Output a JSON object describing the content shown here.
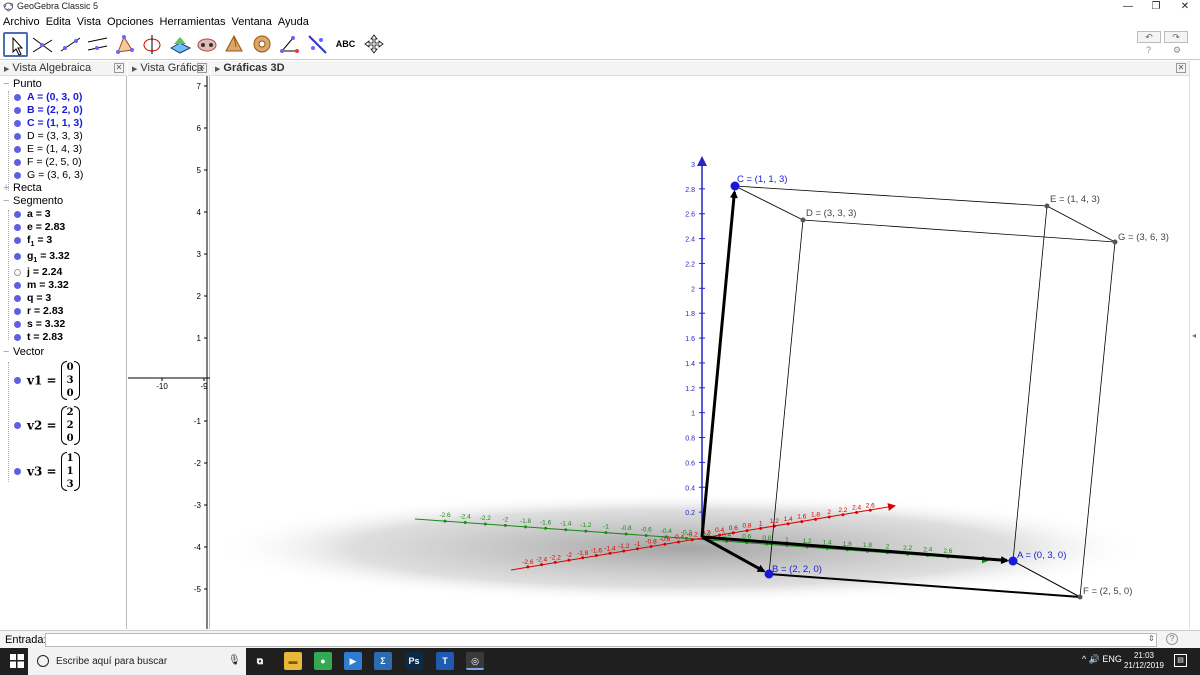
{
  "window": {
    "title": "GeoGebra Classic 5",
    "minimize": "—",
    "maximize": "❐",
    "close": "✕"
  },
  "menu": [
    "Archivo",
    "Edita",
    "Vista",
    "Opciones",
    "Herramientas",
    "Ventana",
    "Ayuda"
  ],
  "toolbar": {
    "tools": [
      "move-tool",
      "point-tool",
      "line-tool",
      "perpendicular-tool",
      "polygon-tool",
      "circle-tool",
      "plane-tool",
      "sphere-tool",
      "pyramid-tool",
      "net-tool",
      "angle-tool",
      "reflect-tool",
      "text-tool",
      "transform-tool"
    ],
    "text_tool_label": "ABC",
    "undo": "↶",
    "redo": "↷",
    "help_icon": "?",
    "settings_icon": "⚙"
  },
  "views": {
    "algebra_title": "Vista Algebraica",
    "graphics2d_title": "Vista Gráfica",
    "graphics3d_title": "Gráficas 3D",
    "close_glyph": "✕"
  },
  "algebra": {
    "categories": {
      "punto": "Punto",
      "recta": "Recta",
      "segmento": "Segmento",
      "vector": "Vector"
    },
    "points": [
      {
        "label": "A = (0, 3, 0)",
        "bold": true
      },
      {
        "label": "B = (2, 2, 0)",
        "bold": true
      },
      {
        "label": "C = (1, 1, 3)",
        "bold": true
      },
      {
        "label": "D = (3, 3, 3)",
        "bold": false
      },
      {
        "label": "E = (1, 4, 3)",
        "bold": false
      },
      {
        "label": "F = (2, 5, 0)",
        "bold": false
      },
      {
        "label": "G = (3, 6, 3)",
        "bold": false
      }
    ],
    "segments": [
      {
        "name": "a",
        "sub": "",
        "value": " = 3",
        "hollow": false
      },
      {
        "name": "e",
        "sub": "",
        "value": " = 2.83",
        "hollow": false
      },
      {
        "name": "f",
        "sub": "1",
        "value": " = 3",
        "hollow": false
      },
      {
        "name": "g",
        "sub": "1",
        "value": " = 3.32",
        "hollow": false
      },
      {
        "name": "j",
        "sub": "",
        "value": " = 2.24",
        "hollow": true
      },
      {
        "name": "m",
        "sub": "",
        "value": " = 3.32",
        "hollow": false
      },
      {
        "name": "q",
        "sub": "",
        "value": " = 3",
        "hollow": false
      },
      {
        "name": "r",
        "sub": "",
        "value": " = 2.83",
        "hollow": false
      },
      {
        "name": "s",
        "sub": "",
        "value": " = 3.32",
        "hollow": false
      },
      {
        "name": "t",
        "sub": "",
        "value": " = 2.83",
        "hollow": false
      }
    ],
    "vectors": [
      {
        "name": "v1 =",
        "components": [
          "0",
          "3",
          "0"
        ]
      },
      {
        "name": "v2 =",
        "components": [
          "2",
          "2",
          "0"
        ]
      },
      {
        "name": "v3 =",
        "components": [
          "1",
          "1",
          "3"
        ]
      }
    ]
  },
  "graphics2d": {
    "y_ticks": [
      "7",
      "6",
      "5",
      "4",
      "3",
      "2",
      "1",
      "-1",
      "-2",
      "-3",
      "-4",
      "-5"
    ],
    "x_ticks": [
      "-10",
      "-9"
    ]
  },
  "graphics3d": {
    "z_ticks": [
      "3",
      "2.8",
      "2.6",
      "2.4",
      "2.2",
      "2",
      "1.8",
      "1.6",
      "1.4",
      "1.2",
      "1",
      "0.8",
      "0.6",
      "0.4",
      "0.2"
    ],
    "green_ticks": [
      "-2.6",
      "-2.4",
      "-2.2",
      "-2",
      "-1.8",
      "-1.6",
      "-1.4",
      "-1.2",
      "-1",
      "-0.8",
      "-0.6",
      "-0.4",
      "-0.2",
      "0.2",
      "0.4",
      "0.6",
      "0.8",
      "1",
      "1.2",
      "1.4",
      "1.6",
      "1.8",
      "2",
      "2.2",
      "2.4",
      "2.6"
    ],
    "red_ticks": [
      "-2.6",
      "-2.4",
      "-2.2",
      "-2",
      "-1.8",
      "-1.6",
      "-1.4",
      "-1.2",
      "-1",
      "-0.8",
      "-0.6",
      "-0.4",
      "-0.2",
      "0.2",
      "0.4",
      "0.6",
      "0.8",
      "1",
      "1.2",
      "1.4",
      "1.6",
      "1.8",
      "2",
      "2.2",
      "2.4",
      "2.6"
    ],
    "point_labels": {
      "A": "A = (0, 3, 0)",
      "B": "B = (2, 2, 0)",
      "C": "C = (1, 1, 3)",
      "D": "D = (3, 3, 3)",
      "E": "E = (1, 4, 3)",
      "F": "F = (2, 5, 0)",
      "G": "G = (3, 6, 3)"
    }
  },
  "input": {
    "label": "Entrada:",
    "value": "",
    "spinner": "⇕",
    "help": "?"
  },
  "taskbar": {
    "search_placeholder": "Escribe aquí para buscar",
    "mic": "🎙",
    "time": "21:03",
    "date": "21/12/2019",
    "tray": "^ 🔊 ENG",
    "apps": [
      {
        "name": "task-view",
        "label": "⧉",
        "color": "#1f1f1f"
      },
      {
        "name": "file-explorer",
        "label": "▬",
        "color": "#e8b838"
      },
      {
        "name": "chrome",
        "label": "●",
        "color": "#34a853"
      },
      {
        "name": "media-app",
        "label": "▶",
        "color": "#2d7dd2"
      },
      {
        "name": "sigma-app",
        "label": "Σ",
        "color": "#2b6cb0"
      },
      {
        "name": "photoshop",
        "label": "Ps",
        "color": "#0a2a48"
      },
      {
        "name": "word-app",
        "label": "T",
        "color": "#1e5bb0"
      },
      {
        "name": "geogebra",
        "label": "◎",
        "color": "#ffffff"
      }
    ]
  }
}
